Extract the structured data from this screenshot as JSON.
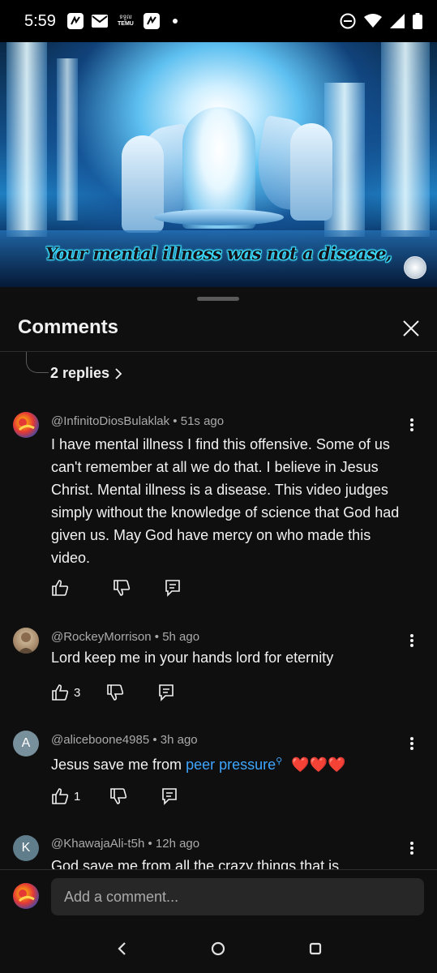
{
  "status_bar": {
    "time": "5:59",
    "notification_icons": [
      "app-icon",
      "mail-icon",
      "temu-icon",
      "app-icon"
    ],
    "temu_label_top": "ទទួល",
    "temu_label": "TEMU",
    "system_icons": [
      "do-not-disturb-icon",
      "wifi-icon",
      "signal-icon",
      "battery-icon"
    ]
  },
  "video": {
    "caption": "Your mental illness was not a disease,"
  },
  "comments_panel": {
    "title": "Comments",
    "replies_link": "2 replies",
    "comments": [
      {
        "author": "@InfinitoDiosBulaklak",
        "time": "51s ago",
        "text": "I have mental illness I find this offensive. Some of us can't remember at all we do that. I believe in Jesus Christ. Mental illness is a disease. This video judges simply without the knowledge of science that God had given us. May God have mercy on who made this video.",
        "likes": ""
      },
      {
        "author": "@RockeyMorrison",
        "time": "5h ago",
        "text": "Lord keep me in your hands lord for eternity",
        "likes": "3"
      },
      {
        "author": "@aliceboone4985",
        "avatar_letter": "A",
        "time": "3h ago",
        "text_prefix": "Jesus save me from ",
        "text_link": "peer pressure",
        "text_suffix": "❤️❤️❤️",
        "likes": "1"
      },
      {
        "author": "@KhawajaAli-t5h",
        "avatar_letter": "K",
        "time": "12h ago",
        "text": "God save me from all the crazy things that is"
      }
    ],
    "input_placeholder": "Add a comment..."
  },
  "colors": {
    "background": "#0f0f0f",
    "text_primary": "#f1f1f1",
    "text_secondary": "#aaaaaa",
    "link": "#3ea6ff",
    "caption_glow": "#3fe0ff"
  }
}
